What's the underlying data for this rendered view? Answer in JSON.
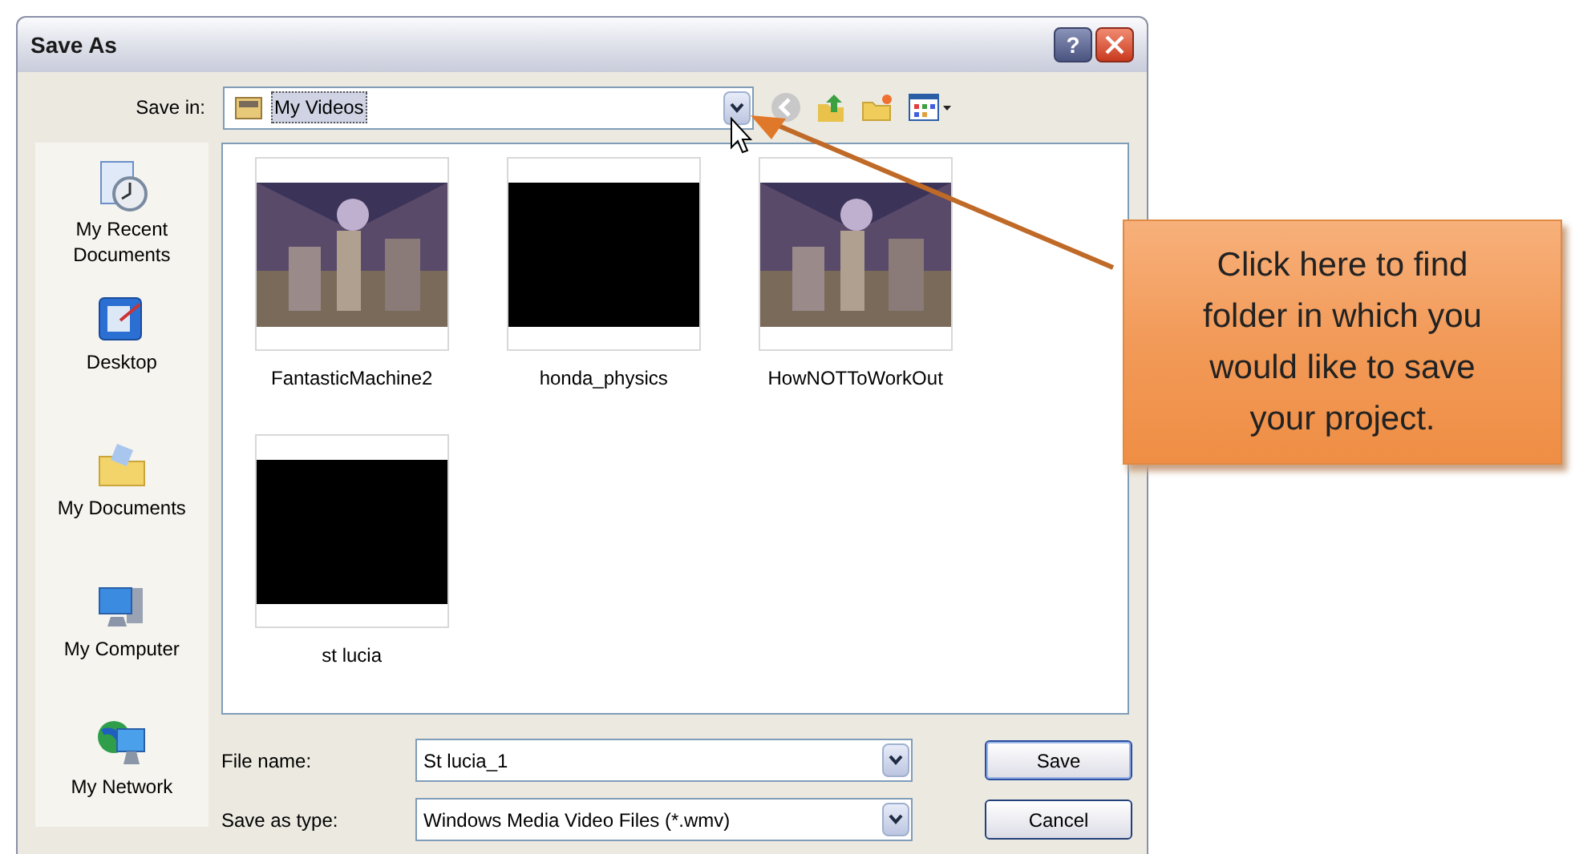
{
  "window": {
    "title": "Save As",
    "buttons": [
      "?"
    ]
  },
  "save_in": {
    "label": "Save in:",
    "value": "My Videos"
  },
  "places": [
    {
      "label": "My Recent Documents"
    },
    {
      "label": "Desktop"
    },
    {
      "label": "My Documents"
    },
    {
      "label": "My Computer"
    },
    {
      "label": "My Network"
    }
  ],
  "files": [
    {
      "name": "FantasticMachine2",
      "kind": "picture"
    },
    {
      "name": "honda_physics",
      "kind": "blank"
    },
    {
      "name": "HowNOTToWorkOut",
      "kind": "picture"
    },
    {
      "name": "st lucia",
      "kind": "blank"
    }
  ],
  "file_name": {
    "label": "File name:",
    "value": "St lucia_1"
  },
  "save_as_type": {
    "label": "Save as type:",
    "value": "Windows Media Video Files (*.wmv)"
  },
  "actions": [
    "Save",
    "Cancel"
  ],
  "callout": {
    "text": "Click here to find folder in which you would like to save your project."
  }
}
